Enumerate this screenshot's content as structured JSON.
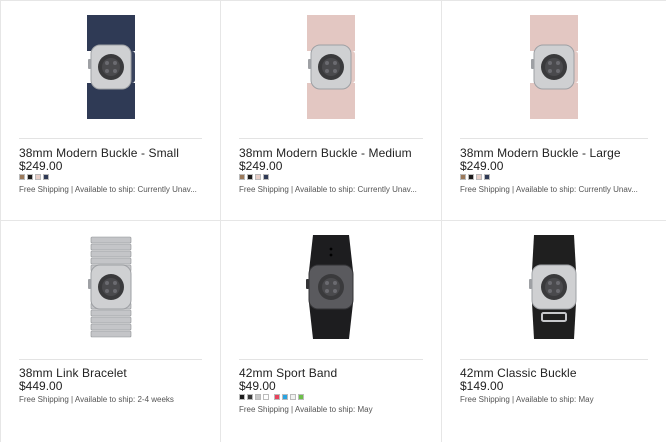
{
  "products": [
    {
      "title": "38mm Modern Buckle - Small",
      "price": "$249.00",
      "shipping": "Free Shipping | Available to ship: Currently Unav...",
      "band_color": "#2f3a55",
      "image": "watch-modern-buckle-midnight-blue",
      "swatches": [
        "#9b7a5b",
        "#1b1b1b",
        "#e8cfc8",
        "#2f3a55"
      ]
    },
    {
      "title": "38mm Modern Buckle - Medium",
      "price": "$249.00",
      "shipping": "Free Shipping | Available to ship: Currently Unav...",
      "band_color": "#e3c7c2",
      "image": "watch-modern-buckle-soft-pink",
      "swatches": [
        "#9b7a5b",
        "#1b1b1b",
        "#e8cfc8",
        "#2f3a55"
      ]
    },
    {
      "title": "38mm Modern Buckle - Large",
      "price": "$249.00",
      "shipping": "Free Shipping | Available to ship: Currently Unav...",
      "band_color": "#e3c7c2",
      "image": "watch-modern-buckle-soft-pink",
      "swatches": [
        "#9b7a5b",
        "#1b1b1b",
        "#e8cfc8",
        "#2f3a55"
      ]
    },
    {
      "title": "38mm Link Bracelet",
      "price": "$449.00",
      "shipping": "Free Shipping | Available to ship: 2-4 weeks",
      "band_color": "#b8b8bb",
      "image": "watch-link-bracelet",
      "swatches": []
    },
    {
      "title": "42mm Sport Band",
      "price": "$49.00",
      "shipping": "Free Shipping | Available to ship: May",
      "band_color": "#1d1d1f",
      "image": "watch-sport-band-black",
      "swatches": [
        "#1b1b1b",
        "#3a3a3a",
        "#c8c8c8",
        "#ffffff",
        "#e8425c",
        "#2aa3e0",
        "#f2f2f2",
        "#6dc04a"
      ]
    },
    {
      "title": "42mm Classic Buckle",
      "price": "$149.00",
      "shipping": "Free Shipping | Available to ship: May",
      "band_color": "#1f1f1f",
      "image": "watch-classic-buckle-black",
      "swatches": []
    }
  ]
}
